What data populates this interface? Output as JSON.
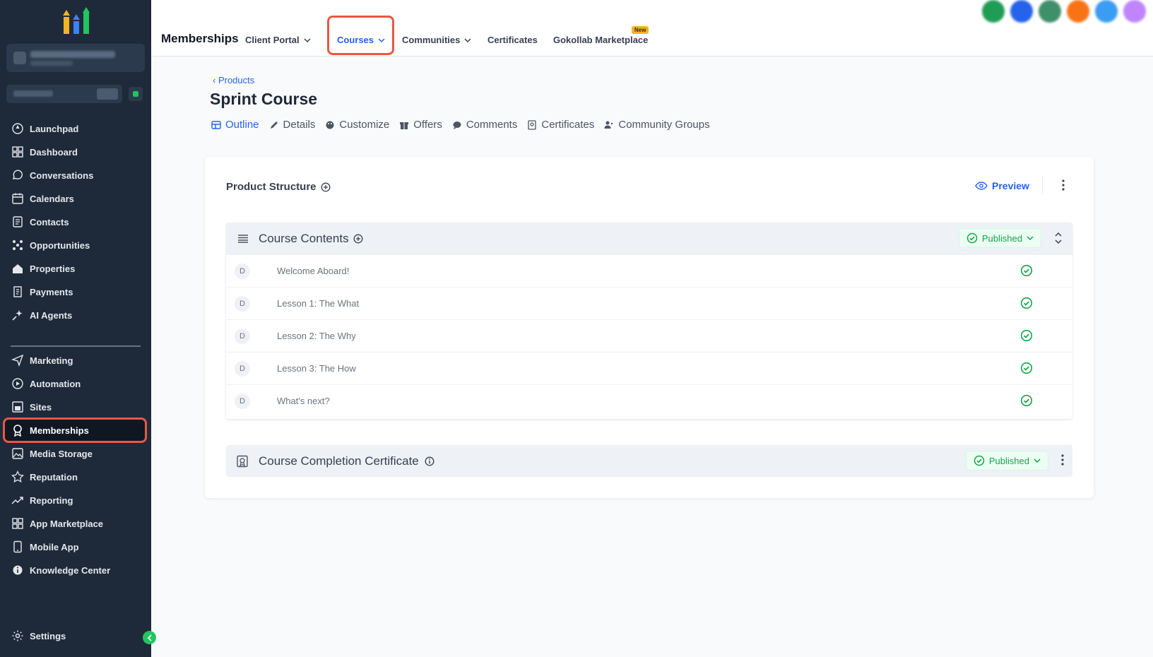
{
  "sidebar": {
    "items": [
      {
        "label": "Launchpad",
        "icon": "rocket-icon"
      },
      {
        "label": "Dashboard",
        "icon": "dashboard-icon"
      },
      {
        "label": "Conversations",
        "icon": "chat-icon"
      },
      {
        "label": "Calendars",
        "icon": "calendar-icon"
      },
      {
        "label": "Contacts",
        "icon": "contacts-icon"
      },
      {
        "label": "Opportunities",
        "icon": "opportunities-icon"
      },
      {
        "label": "Properties",
        "icon": "home-icon"
      },
      {
        "label": "Payments",
        "icon": "receipt-icon"
      },
      {
        "label": "AI Agents",
        "icon": "sparkle-icon"
      }
    ],
    "items2": [
      {
        "label": "Marketing",
        "icon": "send-icon"
      },
      {
        "label": "Automation",
        "icon": "automation-icon"
      },
      {
        "label": "Sites",
        "icon": "sites-icon"
      },
      {
        "label": "Memberships",
        "icon": "award-icon"
      },
      {
        "label": "Media Storage",
        "icon": "image-icon"
      },
      {
        "label": "Reputation",
        "icon": "star-icon"
      },
      {
        "label": "Reporting",
        "icon": "trend-icon"
      },
      {
        "label": "App Marketplace",
        "icon": "apps-icon"
      },
      {
        "label": "Mobile App",
        "icon": "mobile-icon"
      },
      {
        "label": "Knowledge Center",
        "icon": "info-icon"
      }
    ],
    "settings": "Settings",
    "active": "Memberships"
  },
  "topbar": {
    "title": "Memberships",
    "tabs": [
      "Client Portal",
      "Courses",
      "Communities",
      "Certificates",
      "Gokollab Marketplace"
    ],
    "new_badge": "New",
    "active_tab": "Courses"
  },
  "page": {
    "back_link": "Products",
    "title": "Sprint Course",
    "subtabs": [
      "Outline",
      "Details",
      "Customize",
      "Offers",
      "Comments",
      "Certificates",
      "Community Groups"
    ]
  },
  "card": {
    "heading": "Product Structure",
    "preview": "Preview",
    "section_title": "Course Contents",
    "section_status": "Published",
    "lessons": [
      {
        "badge": "D",
        "title": "Welcome Aboard!"
      },
      {
        "badge": "D",
        "title": "Lesson 1: The What"
      },
      {
        "badge": "D",
        "title": "Lesson 2: The Why"
      },
      {
        "badge": "D",
        "title": "Lesson 3: The How"
      },
      {
        "badge": "D",
        "title": "What's next?"
      }
    ],
    "certificate_title": "Course Completion Certificate",
    "certificate_status": "Published"
  },
  "colors": {
    "accent": "#2563eb",
    "sidebar": "#1e2a3a",
    "success": "#16a34a",
    "highlight": "#e45a44"
  }
}
